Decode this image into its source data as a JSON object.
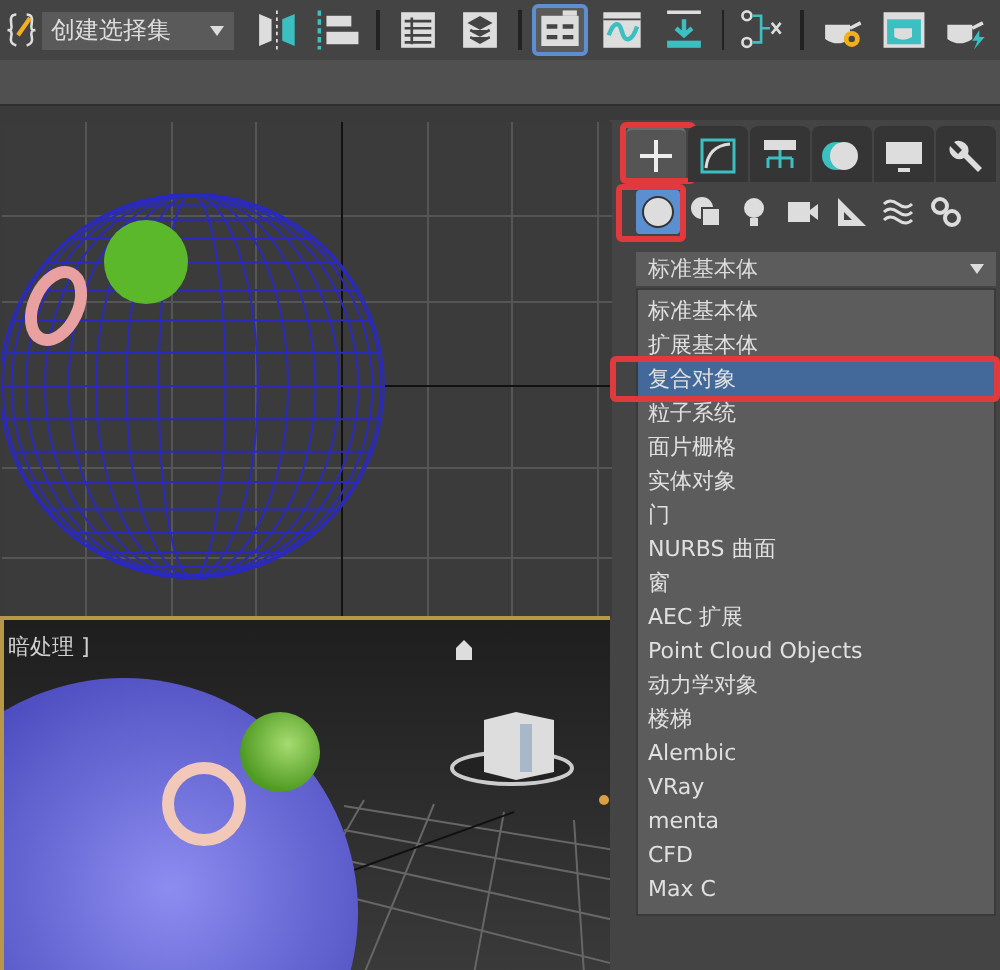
{
  "toolbar": {
    "selection_set": {
      "value": "创建选择集"
    },
    "buttons": [
      {
        "selected": false
      },
      {
        "selected": false
      },
      {
        "selected": false
      },
      {
        "selected": false
      },
      {
        "selected": true
      },
      {
        "selected": false
      },
      {
        "selected": false
      },
      {
        "selected": false
      },
      {
        "selected": false
      },
      {
        "selected": false
      },
      {
        "selected": false
      }
    ]
  },
  "viewports": [
    {
      "kind": "wireframe",
      "active": false
    },
    {
      "kind": "shaded",
      "active": true,
      "label": "暗处理 ]"
    }
  ],
  "command_panel": {
    "tabs": [
      {
        "selected": true,
        "highlighted": true
      },
      {
        "selected": false,
        "highlighted": false
      },
      {
        "selected": false,
        "highlighted": false
      },
      {
        "selected": false,
        "highlighted": false
      },
      {
        "selected": false,
        "highlighted": false
      },
      {
        "selected": false,
        "highlighted": false
      }
    ],
    "categories": [
      {
        "selected": true,
        "highlighted": true
      },
      {
        "selected": false,
        "highlighted": false
      },
      {
        "selected": false,
        "highlighted": false
      },
      {
        "selected": false,
        "highlighted": false
      },
      {
        "selected": false,
        "highlighted": false
      },
      {
        "selected": false,
        "highlighted": false
      },
      {
        "selected": false,
        "highlighted": false
      }
    ],
    "object_type": {
      "value": "标准基本体"
    },
    "object_type_list": [
      {
        "label": "标准基本体",
        "selected": false,
        "highlighted": false
      },
      {
        "label": "扩展基本体",
        "selected": false,
        "highlighted": false
      },
      {
        "label": "复合对象",
        "selected": true,
        "highlighted": true
      },
      {
        "label": "粒子系统",
        "selected": false,
        "highlighted": false
      },
      {
        "label": "面片栅格",
        "selected": false,
        "highlighted": false
      },
      {
        "label": "实体对象",
        "selected": false,
        "highlighted": false
      },
      {
        "label": "门",
        "selected": false,
        "highlighted": false
      },
      {
        "label": "NURBS 曲面",
        "selected": false,
        "highlighted": false
      },
      {
        "label": "窗",
        "selected": false,
        "highlighted": false
      },
      {
        "label": "AEC 扩展",
        "selected": false,
        "highlighted": false
      },
      {
        "label": "Point Cloud Objects",
        "selected": false,
        "highlighted": false
      },
      {
        "label": "动力学对象",
        "selected": false,
        "highlighted": false
      },
      {
        "label": "楼梯",
        "selected": false,
        "highlighted": false
      },
      {
        "label": "Alembic",
        "selected": false,
        "highlighted": false
      },
      {
        "label": "VRay",
        "selected": false,
        "highlighted": false
      },
      {
        "label": "menta",
        "selected": false,
        "highlighted": false
      },
      {
        "label": "CFD",
        "selected": false,
        "highlighted": false
      },
      {
        "label": "Max C",
        "selected": false,
        "highlighted": false
      }
    ]
  }
}
